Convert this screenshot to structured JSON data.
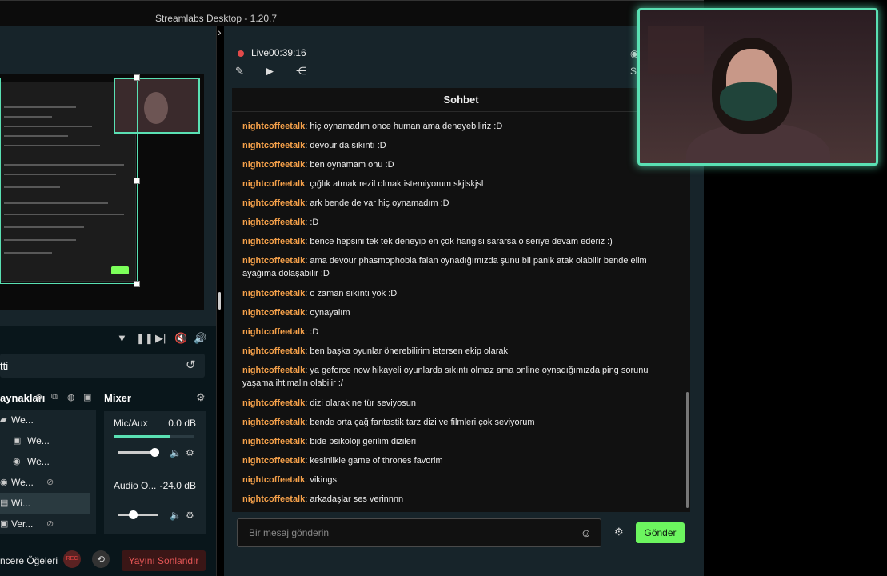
{
  "app": {
    "title": "Streamlabs Desktop - 1.20.7"
  },
  "scene": {
    "name": "tti"
  },
  "sources": {
    "label": "aynakları",
    "items": [
      {
        "name": "We...",
        "icon": "folder-icon"
      },
      {
        "name": "We...",
        "icon": "image-icon"
      },
      {
        "name": "We...",
        "icon": "webcam-icon"
      },
      {
        "name": "We...",
        "icon": "webcam-icon"
      },
      {
        "name": "Wi...",
        "icon": "window-icon"
      },
      {
        "name": "Ver...",
        "icon": "image-icon"
      }
    ]
  },
  "mixer": {
    "label": "Mixer",
    "channels": [
      {
        "name": "Mic/Aux",
        "db": "0.0 dB",
        "level": 0.7,
        "volume": 0.9
      },
      {
        "name": "Audio O...",
        "db": "-24.0 dB",
        "level": 0,
        "volume": 0.35
      }
    ]
  },
  "bottom": {
    "editor_label": "ncere Öğeleri",
    "rec_label": "REC",
    "end_stream": "Yayını Sonlandır"
  },
  "stream": {
    "status": "Live",
    "timer": "00:39:16",
    "side_label": "S"
  },
  "chat": {
    "title": "Sohbet",
    "messages": [
      {
        "user": "nightcoffeetalk",
        "text": "hiç oynamadım once human ama deneyebiliriz :D"
      },
      {
        "user": "nightcoffeetalk",
        "text": "devour da sıkıntı :D"
      },
      {
        "user": "nightcoffeetalk",
        "text": "ben oynamam onu :D"
      },
      {
        "user": "nightcoffeetalk",
        "text": "çığlık atmak rezil olmak istemiyorum skjlskjsl"
      },
      {
        "user": "nightcoffeetalk",
        "text": "ark bende de var hiç oynamadım :D"
      },
      {
        "user": "nightcoffeetalk",
        "text": ":D"
      },
      {
        "user": "nightcoffeetalk",
        "text": "bence hepsini tek tek deneyip en çok hangisi sararsa o seriye devam ederiz :)"
      },
      {
        "user": "nightcoffeetalk",
        "text": "ama devour phasmophobia falan oynadığımızda şunu bil panik atak olabilir bende elim ayağıma dolaşabilir :D"
      },
      {
        "user": "nightcoffeetalk",
        "text": "o zaman sıkıntı yok :D"
      },
      {
        "user": "nightcoffeetalk",
        "text": "oynayalım"
      },
      {
        "user": "nightcoffeetalk",
        "text": ":D"
      },
      {
        "user": "nightcoffeetalk",
        "text": "ben başka oyunlar önerebilirim istersen ekip olarak"
      },
      {
        "user": "nightcoffeetalk",
        "text": "ya geforce now hikayeli oyunlarda sıkıntı olmaz ama online oynadığımızda ping sorunu yaşama ihtimalin olabilir :/"
      },
      {
        "user": "nightcoffeetalk",
        "text": "dizi olarak ne tür seviyosun"
      },
      {
        "user": "nightcoffeetalk",
        "text": "bende orta çağ fantastik tarz dizi ve filmleri çok seviyorum"
      },
      {
        "user": "nightcoffeetalk",
        "text": "bide psikoloji gerilim dizileri"
      },
      {
        "user": "nightcoffeetalk",
        "text": "kesinlikle game of thrones favorim"
      },
      {
        "user": "nightcoffeetalk",
        "text": "vikings"
      },
      {
        "user": "nightcoffeetalk",
        "text": "arkadaşlar ses verinnnn"
      }
    ],
    "input_placeholder": "Bir mesaj gönderin",
    "send_label": "Gönder"
  },
  "colors": {
    "accent": "#5ae0b3",
    "username": "#f6a14a",
    "send": "#6cf55f",
    "live": "#e24a4a"
  }
}
